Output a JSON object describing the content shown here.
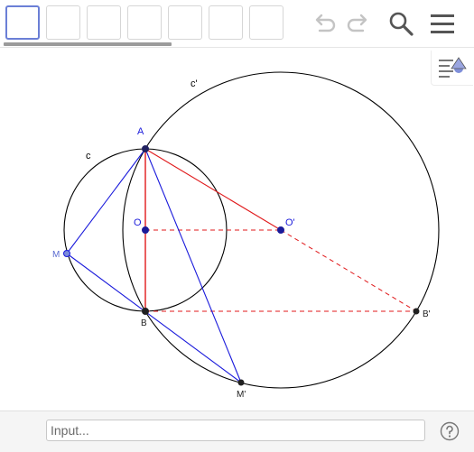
{
  "toolbar": {
    "tools": [
      {
        "name": "tool-1",
        "active": true
      },
      {
        "name": "tool-2",
        "active": false
      },
      {
        "name": "tool-3",
        "active": false
      },
      {
        "name": "tool-4",
        "active": false
      },
      {
        "name": "tool-5",
        "active": false
      },
      {
        "name": "tool-6",
        "active": false
      },
      {
        "name": "tool-7",
        "active": false
      }
    ],
    "icons": [
      "undo-icon",
      "redo-icon",
      "search-icon",
      "menu-icon"
    ]
  },
  "labels": {
    "A": "A",
    "B": "B",
    "O": "O",
    "O_prime": "O'",
    "B_prime": "B'",
    "M": "M",
    "M_prime": "M'",
    "c": "c",
    "c_prime": "c'"
  },
  "colors": {
    "accent_blue": "#1a1adb",
    "line_red": "#e0191b",
    "point_dark": "#202060",
    "circle_black": "#000000",
    "active_tool_border": "#6b7fd6"
  },
  "input": {
    "placeholder": "Input..."
  },
  "help_icon": "help-icon",
  "style_bar_icon": "style-bar-toggle-icon"
}
